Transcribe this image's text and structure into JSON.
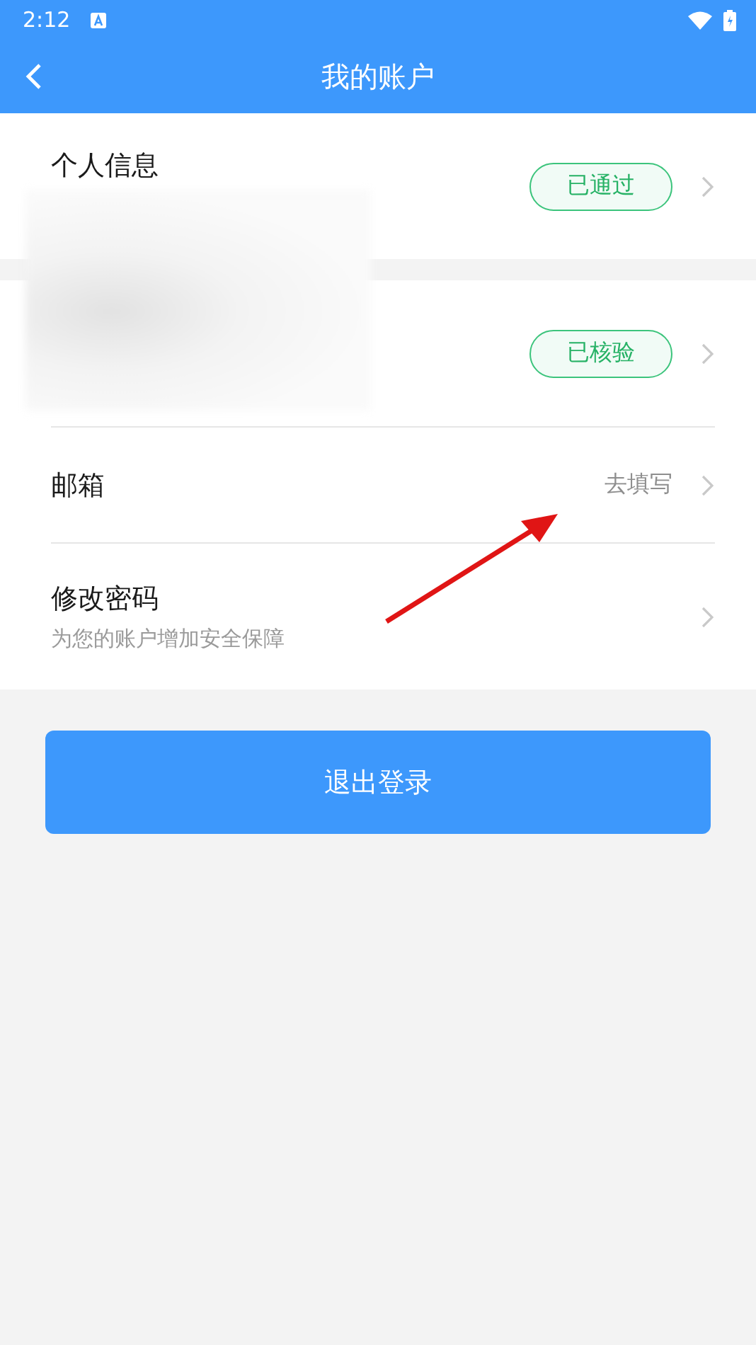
{
  "status_bar": {
    "time": "2:12"
  },
  "header": {
    "title": "我的账户"
  },
  "sections": [
    {
      "rows": [
        {
          "kind": "badge",
          "label": "个人信息",
          "badge": "已通过"
        }
      ]
    },
    {
      "rows": [
        {
          "kind": "badge",
          "badge": "已核验"
        },
        {
          "kind": "value",
          "label": "邮箱",
          "value": "去填写"
        },
        {
          "kind": "subtitle",
          "label": "修改密码",
          "subtitle": "为您的账户增加安全保障"
        }
      ]
    }
  ],
  "logout_button": {
    "label": "退出登录"
  }
}
